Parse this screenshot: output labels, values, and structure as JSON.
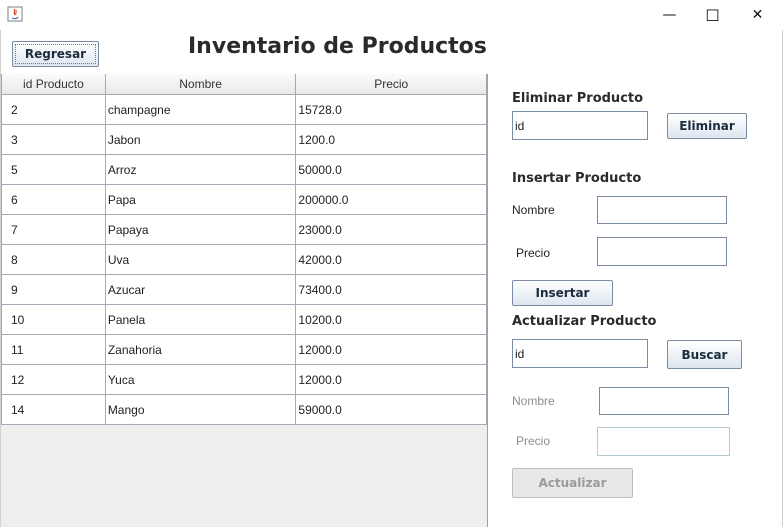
{
  "window": {
    "minimize_glyph": "—",
    "maximize_glyph": "☐",
    "close_glyph": "✕"
  },
  "header": {
    "back_label": "Regresar",
    "title": "Inventario de Productos"
  },
  "table": {
    "columns": [
      "id Producto",
      "Nombre",
      "Precio"
    ],
    "rows": [
      [
        "2",
        "champagne",
        "15728.0"
      ],
      [
        "3",
        "Jabon",
        "1200.0"
      ],
      [
        "5",
        "Arroz",
        "50000.0"
      ],
      [
        "6",
        "Papa",
        "200000.0"
      ],
      [
        "7",
        "Papaya",
        "23000.0"
      ],
      [
        "8",
        "Uva",
        "42000.0"
      ],
      [
        "9",
        "Azucar",
        "73400.0"
      ],
      [
        "10",
        "Panela",
        "10200.0"
      ],
      [
        "11",
        "Zanahoria",
        "12000.0"
      ],
      [
        "12",
        "Yuca",
        "12000.0"
      ],
      [
        "14",
        "Mango",
        "59000.0"
      ]
    ]
  },
  "delete": {
    "title": "Eliminar Producto",
    "id_value": "id",
    "button": "Eliminar"
  },
  "insert": {
    "title": "Insertar Producto",
    "nombre_label": "Nombre",
    "precio_label": "Precio",
    "nombre_value": "",
    "precio_value": "",
    "button": "Insertar"
  },
  "update": {
    "title": "Actualizar Producto",
    "id_value": "id",
    "search_button": "Buscar",
    "nombre_label": "Nombre",
    "precio_label": "Precio",
    "nombre_value": "",
    "precio_value": "",
    "button": "Actualizar"
  },
  "colors": {
    "button_border": "#7a8ba3",
    "disabled_text": "#9a9a9a"
  }
}
